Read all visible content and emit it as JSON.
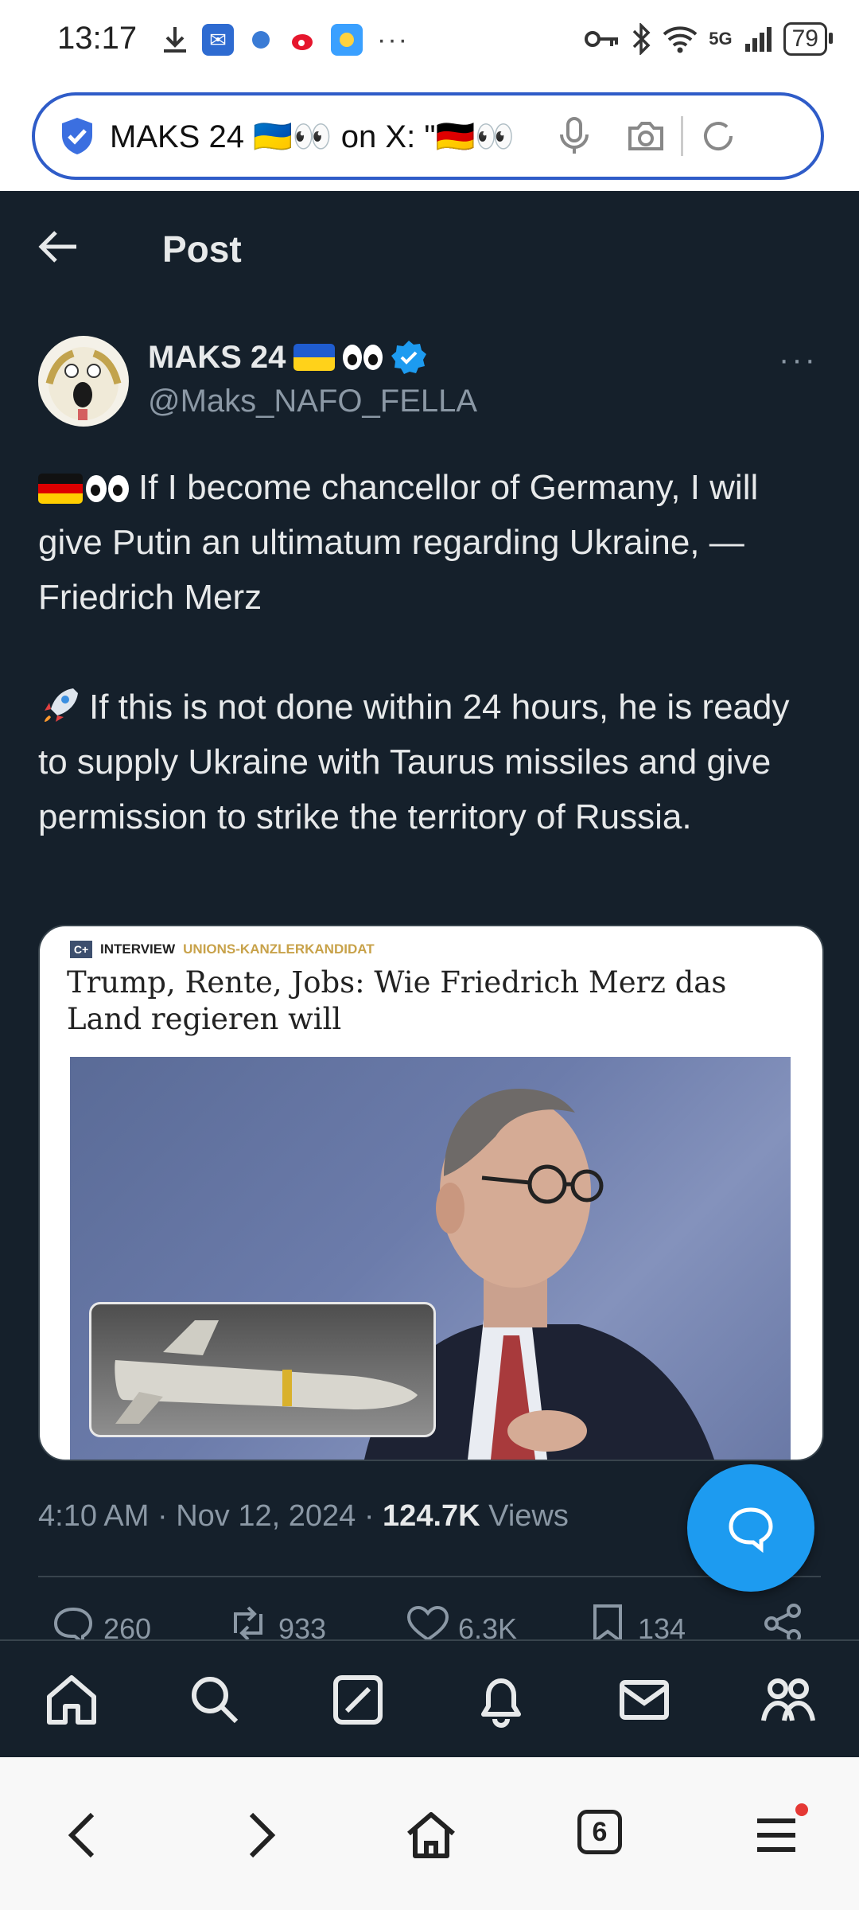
{
  "status_bar": {
    "time": "13:17",
    "network": "5G",
    "battery": "79",
    "more": "···"
  },
  "browser": {
    "url_text": "MAKS 24 🇺🇦👀 on X: \"🇩🇪👀",
    "tab_count": "6"
  },
  "header": {
    "title": "Post"
  },
  "author": {
    "name": "MAKS 24",
    "handle": "@Maks_NAFO_FELLA",
    "more": "···"
  },
  "tweet": {
    "line1": "If I become chancellor of Germany, I will give Putin an ultimatum regarding Ukraine, — Friedrich Merz",
    "line2": "If this is not done within 24 hours, he is ready to supply Ukraine with Taurus missiles and give permission to strike the territory of Russia."
  },
  "media": {
    "logo": "C+",
    "kicker": "INTERVIEW",
    "section": "UNIONS-KANZLERKANDIDAT",
    "headline": "Trump, Rente, Jobs: Wie Friedrich Merz das Land regieren will"
  },
  "meta": {
    "time": "4:10 AM",
    "sep": "·",
    "date": "Nov 12, 2024",
    "views_count": "124.7K",
    "views_label": "Views"
  },
  "actions": {
    "replies": "260",
    "reposts": "933",
    "likes": "6.3K",
    "bookmarks": "134"
  },
  "colors": {
    "background": "#15202b",
    "accent": "#1d9bf0",
    "muted": "#8b98a5",
    "text": "#e7e9ea"
  }
}
